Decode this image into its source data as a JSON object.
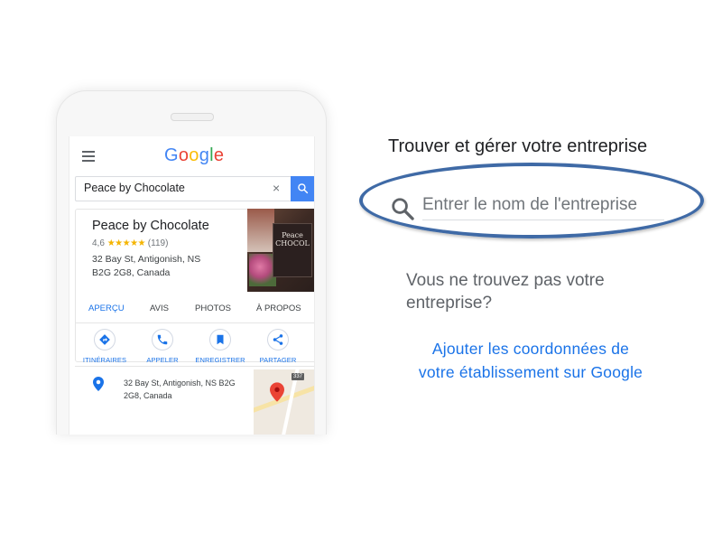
{
  "phone": {
    "brand": {
      "letters": [
        "G",
        "o",
        "o",
        "g",
        "l",
        "e"
      ],
      "colors": [
        "#4285f4",
        "#ea4335",
        "#fbbc05",
        "#4285f4",
        "#34a853",
        "#ea4335"
      ]
    },
    "search": {
      "query": "Peace by Chocolate",
      "clear_glyph": "×"
    },
    "business": {
      "name": "Peace by Chocolate",
      "rating": "4,6",
      "stars": "★★★★★",
      "review_count": "(119)",
      "address_line1": "32 Bay St, Antigonish, NS",
      "address_line2": "B2G 2G8, Canada",
      "photo_sign": "Peace CHOCOL"
    },
    "tabs": [
      "APERÇU",
      "AVIS",
      "PHOTOS",
      "À PROPOS"
    ],
    "actions": [
      "ITINÉRAIRES",
      "APPELER",
      "ENREGISTRER",
      "PARTAGER"
    ],
    "map": {
      "address_line1": "32 Bay St, Antigonish, NS B2G",
      "address_line2": "2G8, Canada",
      "route_shield": "337"
    }
  },
  "panel": {
    "title": "Trouver et gérer votre entreprise",
    "search_placeholder": "Entrer le nom de l'entreprise",
    "not_found_line1": "Vous ne trouvez pas votre",
    "not_found_line2": "entreprise?",
    "add_link_line1": "Ajouter les coordonnées de",
    "add_link_line2": "votre établissement sur Google"
  },
  "colors": {
    "accent_blue": "#1a73e8",
    "highlight_oval": "#3f6aa6",
    "search_button": "#4285f4",
    "star_yellow": "#f4b400",
    "map_pin_red": "#ea4335"
  }
}
